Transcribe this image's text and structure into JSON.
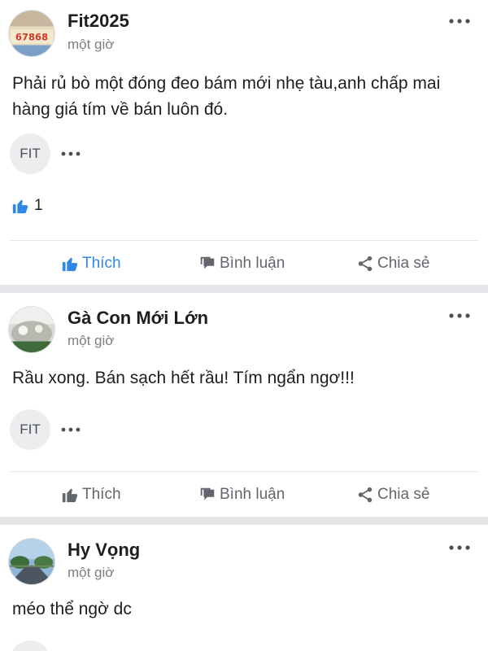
{
  "posts": [
    {
      "author": "Fit2025",
      "time": "một giờ",
      "text": "Phải rủ bò một đóng đeo bám mới nhẹ tàu,anh chấp mai hàng giá tím về bán luôn đó.",
      "tag": "FIT",
      "like_count": "1",
      "avatar_text": "67868",
      "actions": {
        "like": "Thích",
        "comment": "Bình luận",
        "share": "Chia sẻ"
      }
    },
    {
      "author": "Gà Con Mới Lớn",
      "time": "một giờ",
      "text": "Rầu xong. Bán sạch hết rầu! Tím ngẩn ngơ!!!",
      "tag": "FIT",
      "actions": {
        "like": "Thích",
        "comment": "Bình luận",
        "share": "Chia sẻ"
      }
    },
    {
      "author": "Hy Vọng",
      "time": "một giờ",
      "text": "méo thể ngờ dc"
    }
  ],
  "colors": {
    "liked_blue": "#2f88e3",
    "action_gray": "#62666c",
    "separator": "#e4e6ea"
  }
}
